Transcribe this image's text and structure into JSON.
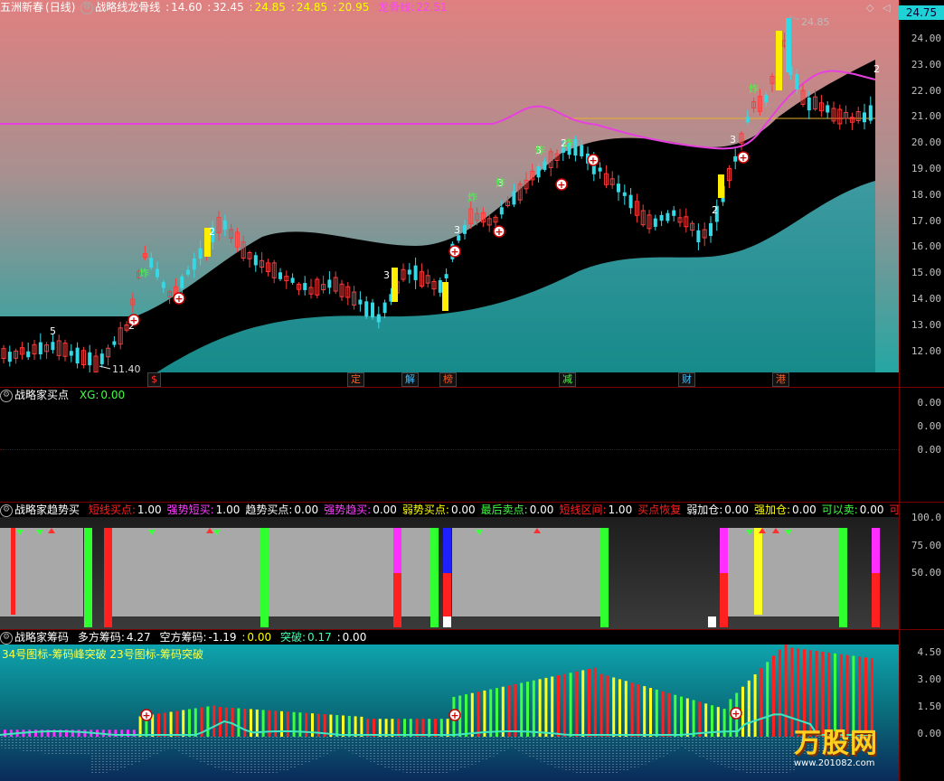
{
  "main": {
    "stock_name": "五洲新春",
    "period": "(日线)",
    "indicator": "战略线龙骨线",
    "values": [
      "14.60",
      "32.45",
      "24.85",
      "24.85",
      "20.95"
    ],
    "value_colors": [
      "#ffffff",
      "#ffffff",
      "#ffff00",
      "#ffff00",
      "#ffff00"
    ],
    "dragon_label": "龙骨线:",
    "dragon_value": "22.51",
    "current_price": "24.75",
    "high_label": "24.85",
    "low_label": "11.40",
    "price_ticks": [
      "24.00",
      "23.00",
      "22.00",
      "21.00",
      "20.00",
      "19.00",
      "18.00",
      "17.00",
      "16.00",
      "15.00",
      "14.00",
      "13.00",
      "12.00"
    ],
    "event_tags": [
      {
        "text": "$",
        "color": "#ff3030"
      },
      {
        "text": "定",
        "color": "#ff5a20"
      },
      {
        "text": "解",
        "color": "#40c0ff"
      },
      {
        "text": "榜",
        "color": "#ff5a20"
      },
      {
        "text": "减",
        "color": "#40ff40"
      },
      {
        "text": "财",
        "color": "#40c0ff"
      },
      {
        "text": "港",
        "color": "#ff5a20"
      }
    ],
    "candle_numbers": [
      "5",
      "2",
      "2",
      "3",
      "3",
      "3",
      "3",
      "2",
      "3",
      "2"
    ],
    "explode_label": "炸"
  },
  "buy": {
    "title": "战略家买点",
    "xg_label": "XG:",
    "xg_value": "0.00",
    "ticks": [
      "0.00",
      "0.00",
      "0.00"
    ]
  },
  "trend": {
    "title": "战略家趋势买",
    "items": [
      {
        "label": "短线买点:",
        "value": "1.00",
        "color": "#ff2020"
      },
      {
        "label": "强势短买:",
        "value": "1.00",
        "color": "#ff40ff"
      },
      {
        "label": "趋势买点:",
        "value": "0.00",
        "color": "#ffffff"
      },
      {
        "label": "强势趋买:",
        "value": "0.00",
        "color": "#ff40ff"
      },
      {
        "label": "弱势买点:",
        "value": "0.00",
        "color": "#ffff00"
      },
      {
        "label": "最后卖点:",
        "value": "0.00",
        "color": "#40ff40"
      },
      {
        "label": "短线区间:",
        "value": "1.00",
        "color": "#ff2020"
      },
      {
        "label": "买点恢复",
        "value": "",
        "color": "#ff2020"
      },
      {
        "label": "弱加仓:",
        "value": "0.00",
        "color": "#ffffff"
      },
      {
        "label": "强加仓:",
        "value": "0.00",
        "color": "#ffff00"
      },
      {
        "label": "可以卖:",
        "value": "0.00",
        "color": "#40ff40"
      },
      {
        "label": "可以",
        "value": "",
        "color": "#ff2020"
      }
    ],
    "ticks": [
      "100.0",
      "75.00",
      "50.00"
    ]
  },
  "chip": {
    "title": "战略家筹码",
    "long_label": "多方筹码:",
    "long_value": "4.27",
    "short_label": "空方筹码:",
    "short_value": "-1.19",
    "mid_value": "0.00",
    "break_label": "突破:",
    "break_value": "0.17",
    "last_value": "0.00",
    "note": "34号图标-筹码峰突破  23号图标-筹码突破",
    "ticks": [
      "4.50",
      "3.00",
      "1.50",
      "0.00"
    ]
  },
  "watermark": {
    "brand": "万股网",
    "url": "www.201082.com"
  },
  "colors": {
    "up": "#ff3a3a",
    "down": "#35d9e6",
    "dragon": "#e840e0",
    "ma": "#e8b030",
    "frame": "#7a0000"
  }
}
